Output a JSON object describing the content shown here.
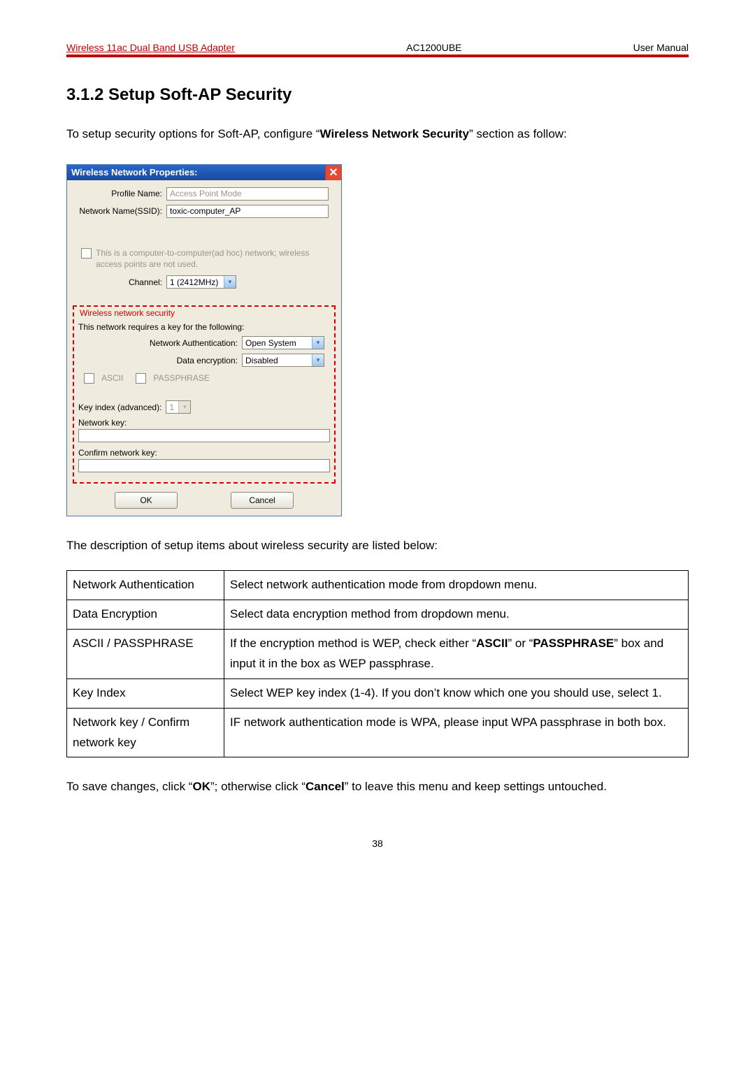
{
  "header": {
    "left": "Wireless 11ac Dual Band USB Adapter",
    "center": "AC1200UBE",
    "right": "User Manual"
  },
  "section_title": "3.1.2 Setup Soft-AP Security",
  "intro_pre": "To setup security options for Soft-AP, configure “",
  "intro_bold": "Wireless Network Security",
  "intro_post": "” section as follow:",
  "dialog": {
    "title": "Wireless Network Properties:",
    "profile_label": "Profile Name:",
    "profile_value": "Access Point Mode",
    "ssid_label": "Network Name(SSID):",
    "ssid_value": "toxic-computer_AP",
    "adhoc_text": "This is a computer-to-computer(ad hoc) network; wireless access points are not used.",
    "channel_label": "Channel:",
    "channel_value": "1 (2412MHz)",
    "sec_legend": "Wireless network security",
    "sec_text": "This network requires a key for the following:",
    "auth_label": "Network Authentication:",
    "auth_value": "Open System",
    "enc_label": "Data encryption:",
    "enc_value": "Disabled",
    "ascii": "ASCII",
    "passphrase": "PASSPHRASE",
    "key_index_label": "Key index (advanced):",
    "key_index_value": "1",
    "netkey_label": "Network key:",
    "confirm_label": "Confirm network key:",
    "ok": "OK",
    "cancel": "Cancel"
  },
  "desc_intro": "The description of setup items about wireless security are listed below:",
  "table": {
    "r1c1": "Network Authentication",
    "r1c2": "Select network authentication mode from dropdown menu.",
    "r2c1": "Data Encryption",
    "r2c2": "Select data encryption method from dropdown menu.",
    "r3c1": "ASCII / PASSPHRASE",
    "r3c2_a": "If the encryption method is WEP, check either “",
    "r3c2_b": "ASCII",
    "r3c2_c": "” or “",
    "r3c2_d": "PASSPHRASE",
    "r3c2_e": "” box and input it in the box as WEP passphrase.",
    "r4c1": "Key Index",
    "r4c2": "Select WEP key index (1-4). If you don’t know which one you should use, select 1.",
    "r5c1": "Network key / Confirm network key",
    "r5c2": "IF network authentication mode is WPA, please input WPA passphrase in both box."
  },
  "footer_a": "To save changes, click “",
  "footer_b": "OK",
  "footer_c": "”; otherwise click “",
  "footer_d": "Cancel",
  "footer_e": "” to leave this menu and keep settings untouched.",
  "page_number": "38"
}
